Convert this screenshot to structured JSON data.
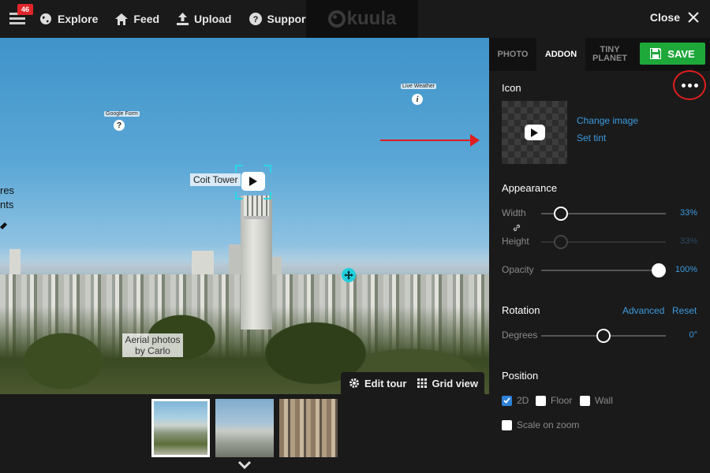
{
  "topbar": {
    "badge": "46",
    "nav": [
      {
        "label": "Explore"
      },
      {
        "label": "Feed"
      },
      {
        "label": "Upload"
      },
      {
        "label": "Support"
      }
    ],
    "logo": "kuula",
    "close_label": "Close"
  },
  "viewer": {
    "hotspot_coit": "Coit Tower",
    "hotspot_google": "Google Form",
    "hotspot_weather": "Live Weather",
    "aerial_line1": "Aerial photos",
    "aerial_line2": "by Carlo",
    "edge_line1": "res",
    "edge_line2": "nts",
    "question_glyph": "?",
    "info_glyph": "i"
  },
  "tour_bar": {
    "edit_label": "Edit tour",
    "grid_label": "Grid view"
  },
  "panel": {
    "tabs": [
      {
        "label": "PHOTO"
      },
      {
        "label": "ADDON"
      },
      {
        "label": "TINY PLANET"
      }
    ],
    "save_label": "SAVE",
    "icon_section": "Icon",
    "change_image": "Change image",
    "set_tint": "Set tint",
    "appearance_section": "Appearance",
    "width_label": "Width",
    "width_value": "33%",
    "height_label": "Height",
    "height_value": "33%",
    "opacity_label": "Opacity",
    "opacity_value": "100%",
    "rotation_section": "Rotation",
    "advanced_link": "Advanced",
    "reset_link": "Reset",
    "degrees_label": "Degrees",
    "degrees_value": "0°",
    "position_section": "Position",
    "pos_2d": "2D",
    "pos_floor": "Floor",
    "pos_wall": "Wall",
    "scale_on_zoom": "Scale on zoom"
  },
  "colors": {
    "accent_blue": "#3d9be0",
    "save_green": "#1ea83a",
    "badge_red": "#e0262b",
    "selection_cyan": "#2ad6e6"
  }
}
